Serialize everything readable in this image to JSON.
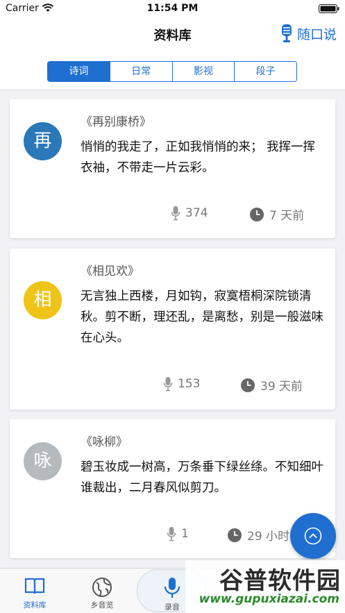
{
  "status": {
    "carrier": "Carrier",
    "time": "11:54 PM"
  },
  "nav": {
    "title": "资料库",
    "right_label": "随口说"
  },
  "tabs": [
    {
      "label": "诗词",
      "active": true
    },
    {
      "label": "日常",
      "active": false
    },
    {
      "label": "影视",
      "active": false
    },
    {
      "label": "段子",
      "active": false
    }
  ],
  "cards": [
    {
      "avatar": "再",
      "avatar_color": "#2a78b8",
      "title": "《再别康桥》",
      "body": "悄悄的我走了，正如我悄悄的来； 我挥一挥衣袖，不带走一片云彩。",
      "count": "374",
      "time": "7 天前"
    },
    {
      "avatar": "相",
      "avatar_color": "#efc418",
      "title": "《相见欢》",
      "body": "无言独上西楼，月如钩，寂寞梧桐深院锁清秋。剪不断，理还乱，是离愁，别是一般滋味在心头。",
      "count": "153",
      "time": "39 天前"
    },
    {
      "avatar": "咏",
      "avatar_color": "#b5babf",
      "title": "《咏柳》",
      "body": "碧玉妆成一树高，万条垂下绿丝绦。不知细叶谁裁出，二月春风似剪刀。",
      "count": "1",
      "time": "29 小时"
    }
  ],
  "tabbar": {
    "library": "资料库",
    "hometown": "乡音览",
    "record": "录音"
  },
  "watermark": {
    "big": "谷普软件园",
    "small": "www.gupuxiazai.com"
  },
  "colors": {
    "accent": "#1e6fd0"
  }
}
